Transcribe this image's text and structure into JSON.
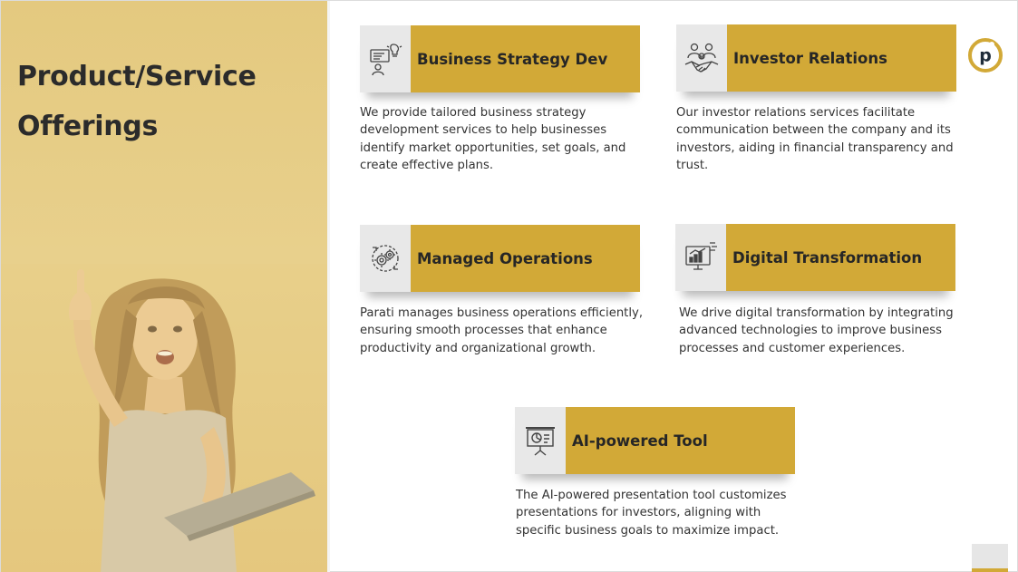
{
  "page": {
    "title": "Product/Service Offerings"
  },
  "colors": {
    "accent": "#d2a937",
    "left_panel": "#e6cc84",
    "icon_box": "#e8e8e8",
    "text": "#333333"
  },
  "cards": [
    {
      "title": "Business Strategy Dev",
      "icon": "strategy-presentation-icon",
      "description": "We provide tailored business strategy development services to help businesses identify market opportunities, set goals, and create effective plans."
    },
    {
      "title": "Investor Relations",
      "icon": "handshake-investors-icon",
      "description": "Our investor relations services facilitate communication between the company and its investors, aiding in financial transparency and trust."
    },
    {
      "title": "Managed Operations",
      "icon": "gears-operations-icon",
      "description": "Parati manages business operations efficiently, ensuring smooth processes that enhance productivity and organizational growth."
    },
    {
      "title": "Digital Transformation",
      "icon": "digital-monitor-icon",
      "description": "We drive digital transformation by integrating advanced technologies to improve business processes and customer experiences."
    },
    {
      "title": "AI-powered Tool",
      "icon": "presentation-board-icon",
      "description": "The AI-powered presentation tool customizes presentations for investors, aligning with specific business goals to maximize impact."
    }
  ],
  "logo": {
    "letter": "p",
    "icon": "parati-logo-icon"
  }
}
